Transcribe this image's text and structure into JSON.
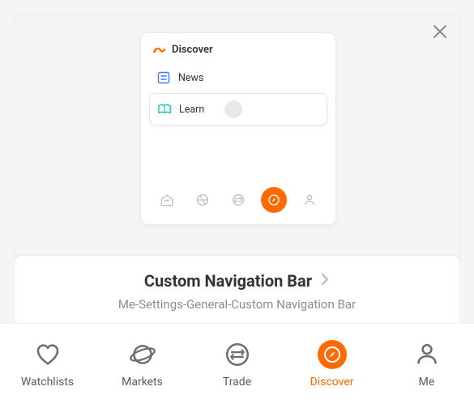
{
  "modal": {
    "title": "Discover",
    "items": [
      {
        "icon": "news-icon",
        "label": "News"
      },
      {
        "icon": "learn-icon",
        "label": "Learn"
      }
    ],
    "mini_nav": [
      {
        "name": "home-icon",
        "active": false
      },
      {
        "name": "markets-icon",
        "active": false
      },
      {
        "name": "trade-icon",
        "active": false
      },
      {
        "name": "compass-icon",
        "active": true
      },
      {
        "name": "person-icon",
        "active": false
      }
    ]
  },
  "card": {
    "title": "Custom Navigation Bar",
    "sub": "Me-Settings-General-Custom Navigation Bar"
  },
  "nav": {
    "items": [
      {
        "name": "watchlists",
        "label": "Watchlists",
        "icon": "heart-icon",
        "active": false
      },
      {
        "name": "markets",
        "label": "Markets",
        "icon": "planet-icon",
        "active": false
      },
      {
        "name": "trade",
        "label": "Trade",
        "icon": "trade-icon",
        "active": false
      },
      {
        "name": "discover",
        "label": "Discover",
        "icon": "compass-icon",
        "active": true
      },
      {
        "name": "me",
        "label": "Me",
        "icon": "person-icon",
        "active": false
      }
    ]
  }
}
